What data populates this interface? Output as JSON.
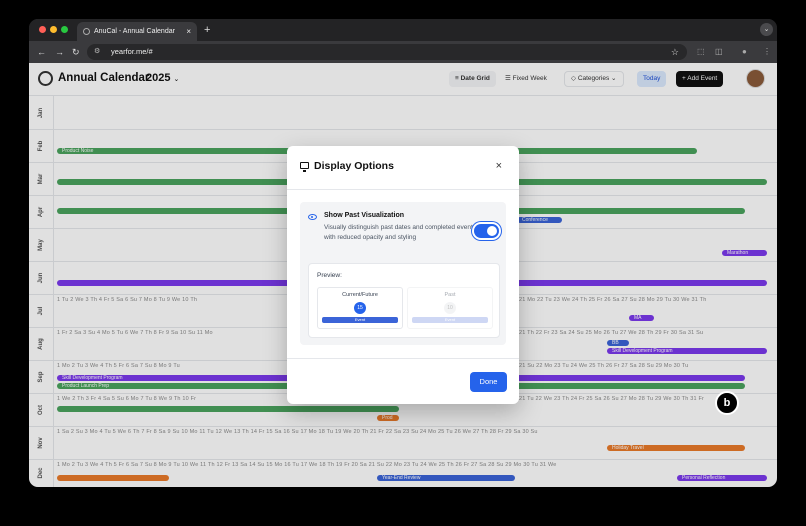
{
  "browser": {
    "tab_title": "AnuCal - Annual Calendar",
    "tab_close": "×",
    "new_tab": "+",
    "tab_menu": "⌄",
    "url": "yearfor.me/#",
    "back": "←",
    "forward": "→",
    "reload": "↻",
    "bookmark": "☆"
  },
  "header": {
    "title": "Annual Calendar",
    "year": "2025",
    "year_caret": "⌄",
    "date_grid_label": "Date Grid",
    "fixed_week_label": "Fixed Week",
    "categories_label": "Categories",
    "today_label": "Today",
    "add_event_label": "Add Event"
  },
  "months": [
    "Jan",
    "Feb",
    "Mar",
    "Apr",
    "May",
    "Jun",
    "Jul",
    "Aug",
    "Sep",
    "Oct",
    "Nov",
    "Dec"
  ],
  "calendar_rows": {
    "jul": "1 Tu  2 We  3 Th  4 Fr  5 Sa  6 Su  7 Mo  8 Tu  9 We  10 Th",
    "jul_right": "21 Mo  22 Tu  23 We  24 Th  25 Fr  26 Sa  27 Su  28 Mo  29 Tu  30 We  31 Th",
    "aug": "1 Fr  2 Sa  3 Su  4 Mo  5 Tu  6 We  7 Th  8 Fr  9 Sa  10 Su  11 Mo",
    "aug_right": "21 Th  22 Fr  23 Sa  24 Su  25 Mo  26 Tu  27 We  28 Th  29 Fr  30 Sa  31 Su",
    "sep": "1 Mo  2 Tu  3 We  4 Th  5 Fr  6 Sa  7 Su  8 Mo  9 Tu",
    "sep_right": "21 Su  22 Mo  23 Tu  24 We  25 Th  26 Fr  27 Sa  28 Su  29 Mo  30 Tu",
    "oct": "1 We  2 Th  3 Fr  4 Sa  5 Su  6 Mo  7 Tu  8 We  9 Th  10 Fr",
    "oct_right": "21 Tu  22 We  23 Th  24 Fr  25 Sa  26 Su  27 Mo  28 Tu  29 We  30 Th  31 Fr",
    "nov": "1 Sa  2 Su  3 Mo  4 Tu  5 We  6 Th  7 Fr  8 Sa  9 Su  10 Mo  11 Tu  12 We  13 Th  14 Fr  15 Sa  16 Su  17 Mo  18 Tu  19 We  20 Th  21 Fr  22 Sa  23 Su  24 Mo  25 Tu  26 We  27 Th  28 Fr  29 Sa  30 Su",
    "dec": "1 Mo  2 Tu  3 We  4 Th  5 Fr  6 Sa  7 Su  8 Mo  9 Tu  10 We  11 Th  12 Fr  13 Sa  14 Su  15 Mo  16 Tu  17 We  18 Th  19 Fr  20 Sa  21 Su  22 Mo  23 Tu  24 We  25 Th  26 Fr  27 Sa  28 Su  29 Mo  30 Tu  31 We"
  },
  "events": {
    "product_noise": "Product Noise",
    "bb_label": "BB",
    "ma_label": "MA",
    "skill_dev": "Skill Development Program",
    "product_launch": "Product Launch Prep",
    "holiday_travel": "Holiday Travel",
    "year_end_review": "Year-End Review",
    "personal_reflection": "Personal Reflection",
    "prod": "Prod",
    "conference": "Conference",
    "marathon": "Marathon"
  },
  "modal": {
    "title": "Display Options",
    "close": "×",
    "option_title": "Show Past Visualization",
    "option_desc": "Visually distinguish past dates and completed events with reduced opacity and styling",
    "toggle_on": true,
    "preview_label": "Preview:",
    "current_label": "Current/Future",
    "current_day": "15",
    "past_label": "Past",
    "past_day": "10",
    "event_label": "Event",
    "done_label": "Done"
  },
  "colors": {
    "accent": "#2563eb",
    "green": "#4aa35e",
    "purple": "#7c3aed",
    "orange": "#ea7a2a",
    "blue_event": "#3b64d8"
  }
}
